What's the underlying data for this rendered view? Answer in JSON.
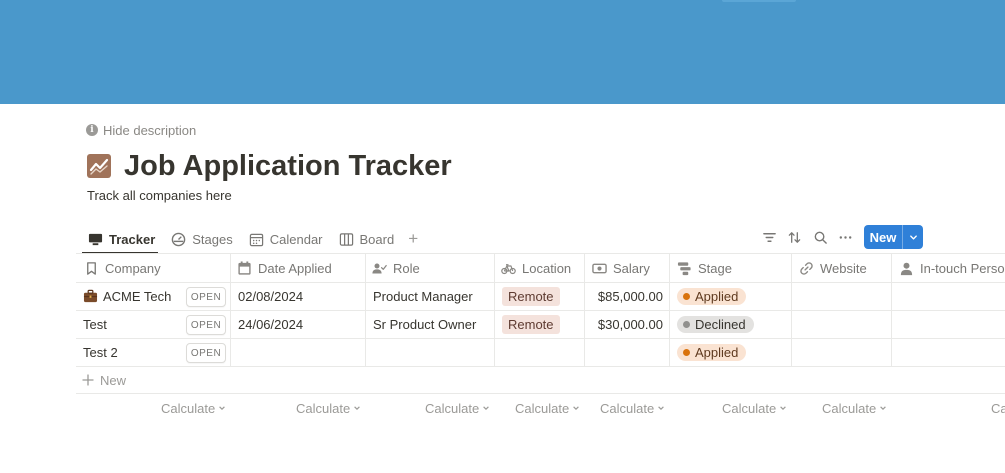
{
  "cover": {
    "color": "#4a98cb"
  },
  "page": {
    "hide_description": "Hide description",
    "title": "Job Application Tracker",
    "description": "Track all companies here",
    "icon": "chart-line-icon"
  },
  "views": [
    {
      "label": "Tracker",
      "icon": "table-icon",
      "active": true
    },
    {
      "label": "Stages",
      "icon": "gauge-icon"
    },
    {
      "label": "Calendar",
      "icon": "calendar-icon"
    },
    {
      "label": "Board",
      "icon": "board-icon"
    }
  ],
  "toolbar": {
    "add_view": "+",
    "new_label": "New",
    "accent": "#2f80d8"
  },
  "columns": [
    {
      "label": "Company",
      "icon": "bookmark-icon"
    },
    {
      "label": "Date Applied",
      "icon": "calendar-icon"
    },
    {
      "label": "Role",
      "icon": "person-check-icon"
    },
    {
      "label": "Location",
      "icon": "bike-icon"
    },
    {
      "label": "Salary",
      "icon": "money-icon"
    },
    {
      "label": "Stage",
      "icon": "stage-icon"
    },
    {
      "label": "Website",
      "icon": "link-icon"
    },
    {
      "label": "In-touch Person",
      "icon": "person-icon"
    }
  ],
  "rows": [
    {
      "company": "ACME Tech",
      "company_icon": "briefcase-icon",
      "open": "OPEN",
      "date": "02/08/2024",
      "role": "Product Manager",
      "location": "Remote",
      "salary": "$85,000.00",
      "stage": "Applied"
    },
    {
      "company": "Test",
      "open": "OPEN",
      "date": "24/06/2024",
      "role": "Sr Product Owner",
      "location": "Remote",
      "salary": "$30,000.00",
      "stage": "Declined"
    },
    {
      "company": "Test 2",
      "open": "OPEN",
      "date": "",
      "role": "",
      "location": "",
      "salary": "",
      "stage": "Applied"
    }
  ],
  "new_row": "New",
  "calculate": "Calculate",
  "calculate_clipped": "Ca",
  "colors": {
    "applied": "#d9730d",
    "declined": "#91918e",
    "remote_bg": "#f4e2dc"
  }
}
